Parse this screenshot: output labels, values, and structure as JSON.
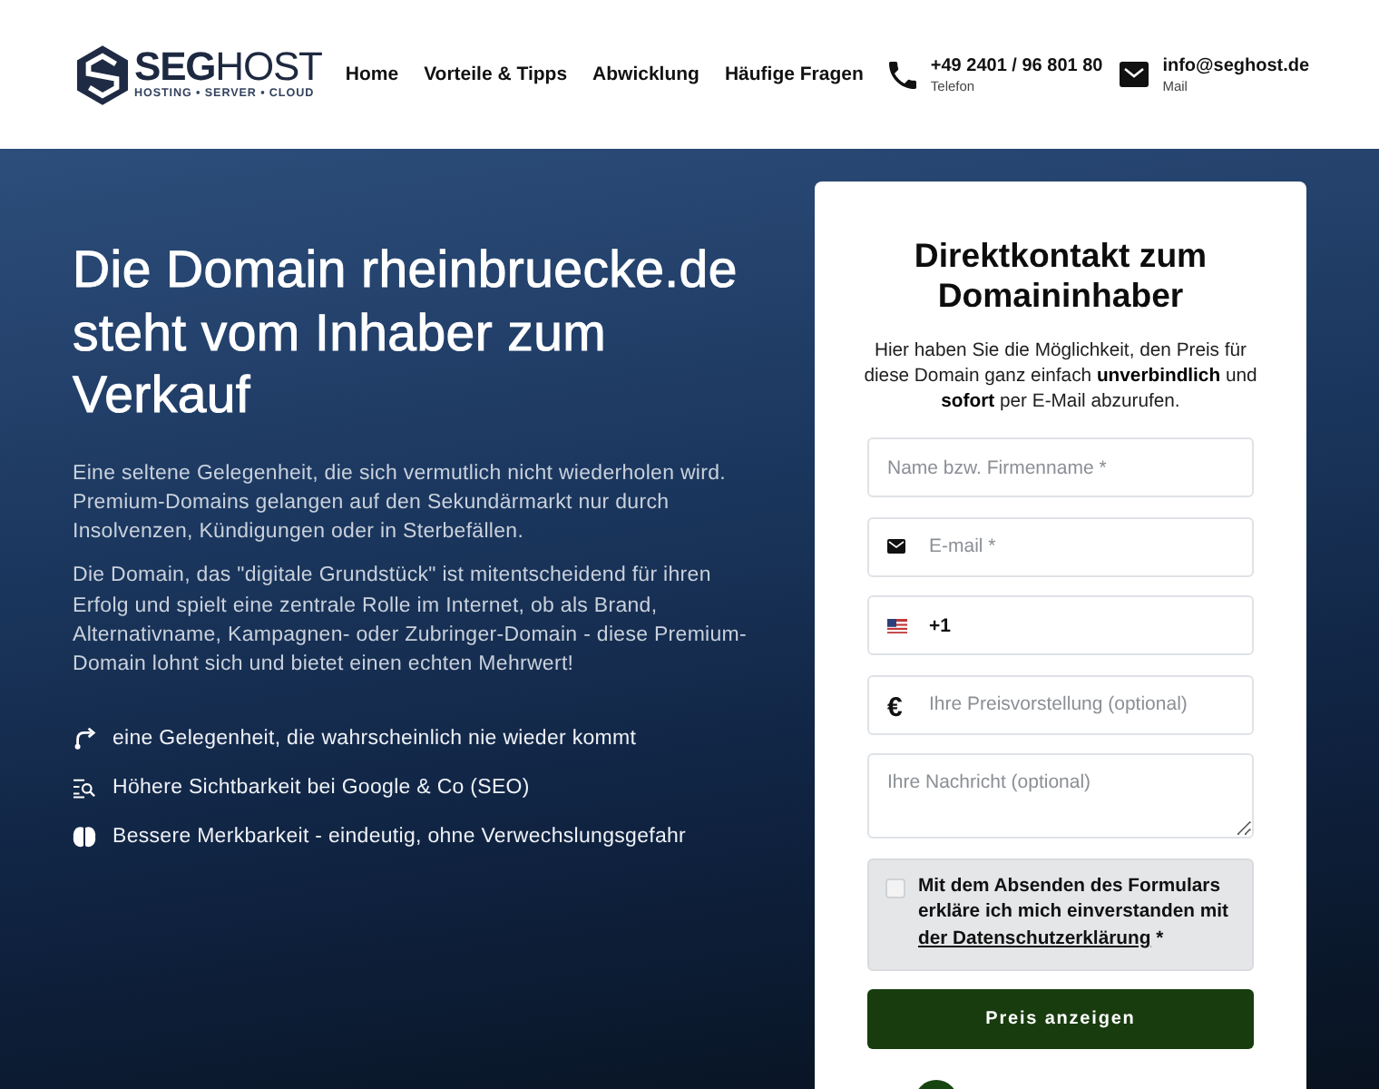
{
  "header": {
    "logo": {
      "name": "**SEG**HOST",
      "tagline": "HOSTING • SERVER • CLOUD"
    },
    "nav": [
      {
        "label": "Home"
      },
      {
        "label": "Vorteile & Tipps"
      },
      {
        "label": "Abwicklung"
      },
      {
        "label": "Häufige Fragen"
      }
    ],
    "contacts": [
      {
        "kind": "phone",
        "value": "+49 2401 / 96 801 80",
        "label": "Telefon"
      },
      {
        "kind": "mail",
        "value": "info@seghost.de",
        "label": "Mail"
      }
    ]
  },
  "hero": {
    "title": "Die Domain rheinbruecke.de steht vom Inhaber zum Verkauf",
    "paragraphs": [
      "Eine seltene Gelegenheit, die sich vermutlich nicht wiederholen wird. Premium-Domains gelangen auf den Sekundärmarkt nur durch Insolvenzen, Kündigungen oder in Sterbefällen.",
      "Die Domain, das \"digitale Grundstück\" ist mitentscheidend für ihren Erfolg und spielt eine zentrale Rolle im Internet, ob als Brand, Alternativname, Kampagnen- oder Zubringer-Domain - diese Premium-Domain lohnt sich und bietet einen echten Mehrwert!"
    ],
    "features": [
      {
        "kind": "route",
        "text": "eine Gelegenheit, die wahrscheinlich nie wieder kommt"
      },
      {
        "kind": "seo",
        "text": "Höhere Sichtbarkeit bei Google & Co (SEO)"
      },
      {
        "kind": "memory",
        "text": "Bessere Merkbarkeit - eindeutig, ohne Verwechslungsgefahr"
      }
    ]
  },
  "contact_form": {
    "title": "Direktkontakt zum Domaininhaber",
    "intro": "Hier haben Sie die Möglichkeit, den Preis für diese Domain ganz einfach **unverbindlich** und **sofort** per E-Mail abzurufen.",
    "fields": [
      {
        "kind": "text",
        "placeholder": "Name bzw. Firmenname *"
      },
      {
        "kind": "email",
        "placeholder": "E-mail *"
      },
      {
        "kind": "phone",
        "value": "+1"
      },
      {
        "kind": "price",
        "prefix": "€",
        "placeholder": "Ihre Preisvorstellung (optional)"
      },
      {
        "kind": "textarea",
        "placeholder": "Ihre Nachricht (optional)"
      }
    ],
    "consent": {
      "checked": false,
      "text": "Mit dem Absenden des Formulars erkläre ich mich einverstanden mit",
      "link": "der Datenschutzerklärung",
      "suffix": "*"
    },
    "submit": "Preis anzeigen"
  }
}
